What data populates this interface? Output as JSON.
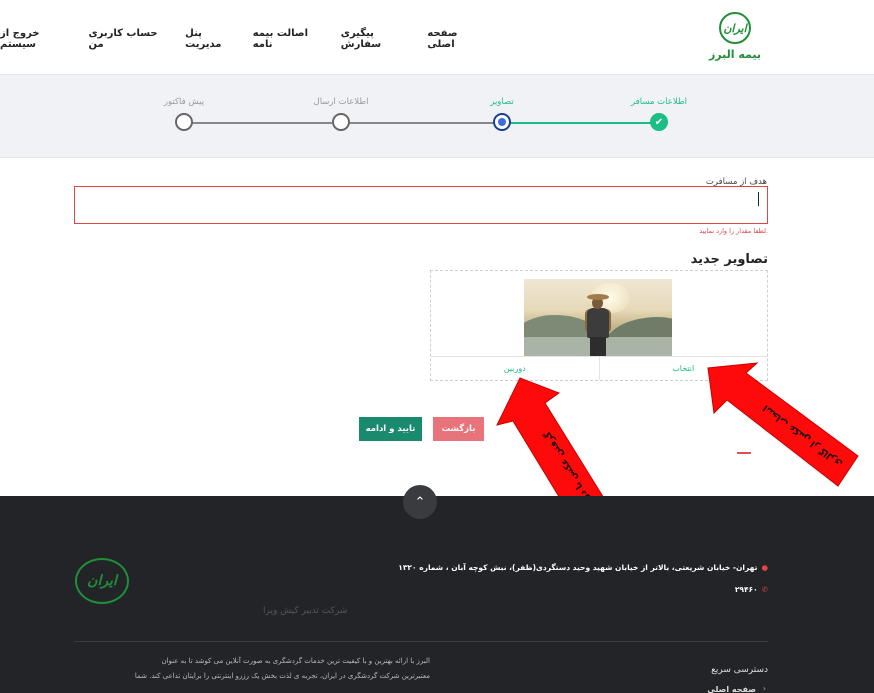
{
  "header": {
    "logo_mark": "ایران",
    "logo_text": "بیمه البرز",
    "nav": [
      "صفحه اصلی",
      "پیگیری سفارش",
      "اصالت بیمه نامه",
      "پنل مدیریت",
      "حساب کاربری من",
      "خروج از سیستم"
    ]
  },
  "stepper": {
    "steps": [
      {
        "label": "اطلاعات مسافر",
        "state": "done"
      },
      {
        "label": "تصاویر",
        "state": "active"
      },
      {
        "label": "اطلاعات ارسال",
        "state": "todo"
      },
      {
        "label": "پیش فاکتور",
        "state": "todo"
      }
    ],
    "check_glyph": "✔"
  },
  "form": {
    "field_label": "هدف از مسافرت",
    "field_value": "",
    "error_text": "لطفا مقدار را وارد نمایید.",
    "section_title": "تصاویر جدید",
    "camera_label": "دوربین",
    "choose_label": "انتخاب",
    "back_button": "بازگشت",
    "confirm_button": "تایید و ادامه"
  },
  "annotations": {
    "arrow_camera": "گرفتن عکس با دوربین",
    "arrow_gallery": "انتخاب عکس از گالری"
  },
  "footer": {
    "scroll_top_glyph": "⌃",
    "logo_mark": "ایران",
    "address": "تهران- خیابان شریعتی، بالاتر از خیابان شهید وحید دستگردی(ظفر)، نبش کوچه آبان ، شماره ۱۳۲۰",
    "phone": "۲۹۴۶۰",
    "company": "شرکت تدبیر کیش ویرا",
    "about_line1": "البرز با ارائه بهترین و با کیفیت ترین خدمات گردشگری به صورت آنلاین می کوشد تا به عنوان",
    "about_line2": "معتبرترین شرکت گردشگری در ایران، تجربه ی لذت بخش یک رزرو اینترنتی را برایتان تداعی کند. شما",
    "quick_access": "دسترسی سریع",
    "quick_link_home": "صفحه اصلی"
  },
  "colors": {
    "brand_green": "#1f8f3a",
    "step_green": "#1bbf86",
    "error_red": "#e04646",
    "footer_bg": "#232427"
  }
}
